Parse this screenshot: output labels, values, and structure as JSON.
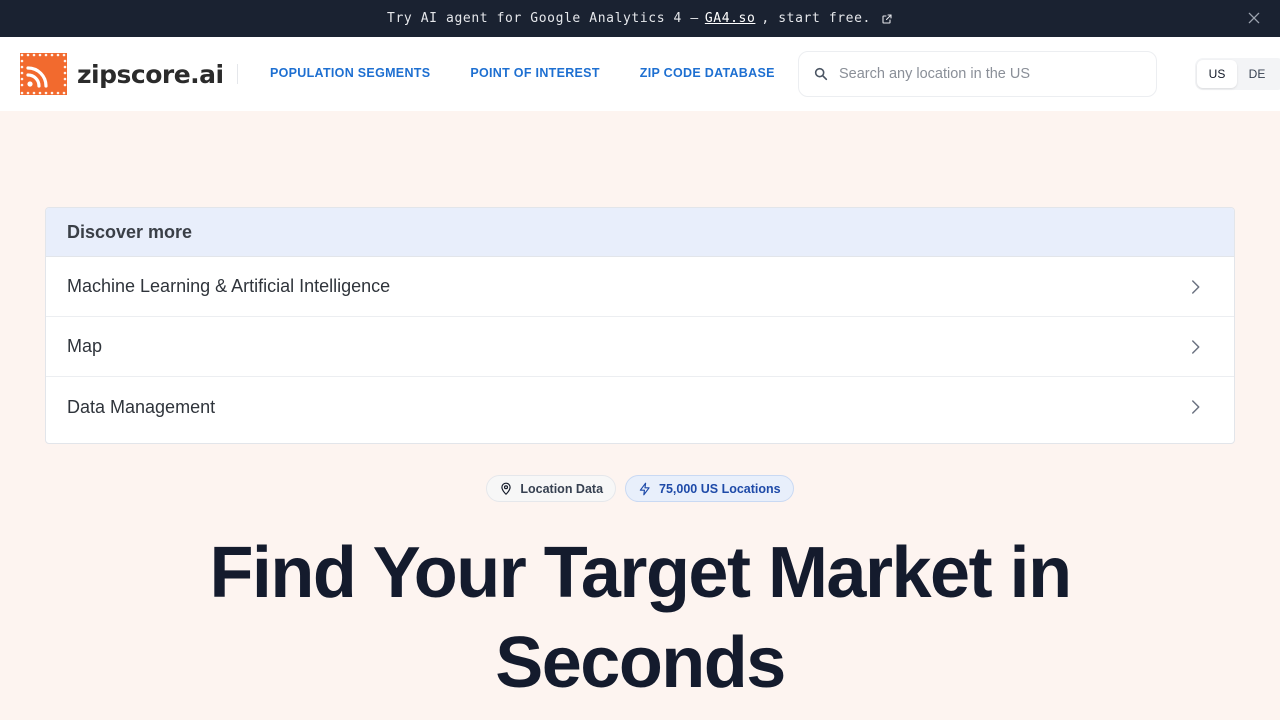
{
  "banner": {
    "text_before": "Try AI agent for Google Analytics 4 –",
    "link": "GA4.so",
    "text_after": ", start free."
  },
  "header": {
    "logo_text": "zipscore.ai",
    "nav": [
      {
        "label": "POPULATION SEGMENTS"
      },
      {
        "label": "POINT OF INTEREST"
      },
      {
        "label": "ZIP CODE DATABASE"
      }
    ],
    "search": {
      "placeholder": "Search any location in the US",
      "value": ""
    },
    "languages": [
      {
        "label": "US",
        "active": true
      },
      {
        "label": "DE",
        "active": false
      }
    ]
  },
  "discover": {
    "title": "Discover more",
    "items": [
      {
        "label": "Machine Learning & Artificial Intelligence"
      },
      {
        "label": "Map"
      },
      {
        "label": "Data Management"
      }
    ]
  },
  "badges": {
    "location": "Location Data",
    "count": "75,000 US Locations"
  },
  "hero": {
    "line1": "Find Your Target Market in",
    "line2": "Seconds"
  },
  "colors": {
    "brand_orange": "#f26a2e",
    "link_blue": "#1d6fd1",
    "banner_bg": "#1a2231",
    "page_bg": "#fdf4f0"
  },
  "icons": {
    "external": "external-link-icon",
    "close": "close-icon",
    "search": "search-icon",
    "chevron": "chevron-right-icon",
    "pin": "map-pin-icon",
    "bolt": "lightning-icon"
  }
}
